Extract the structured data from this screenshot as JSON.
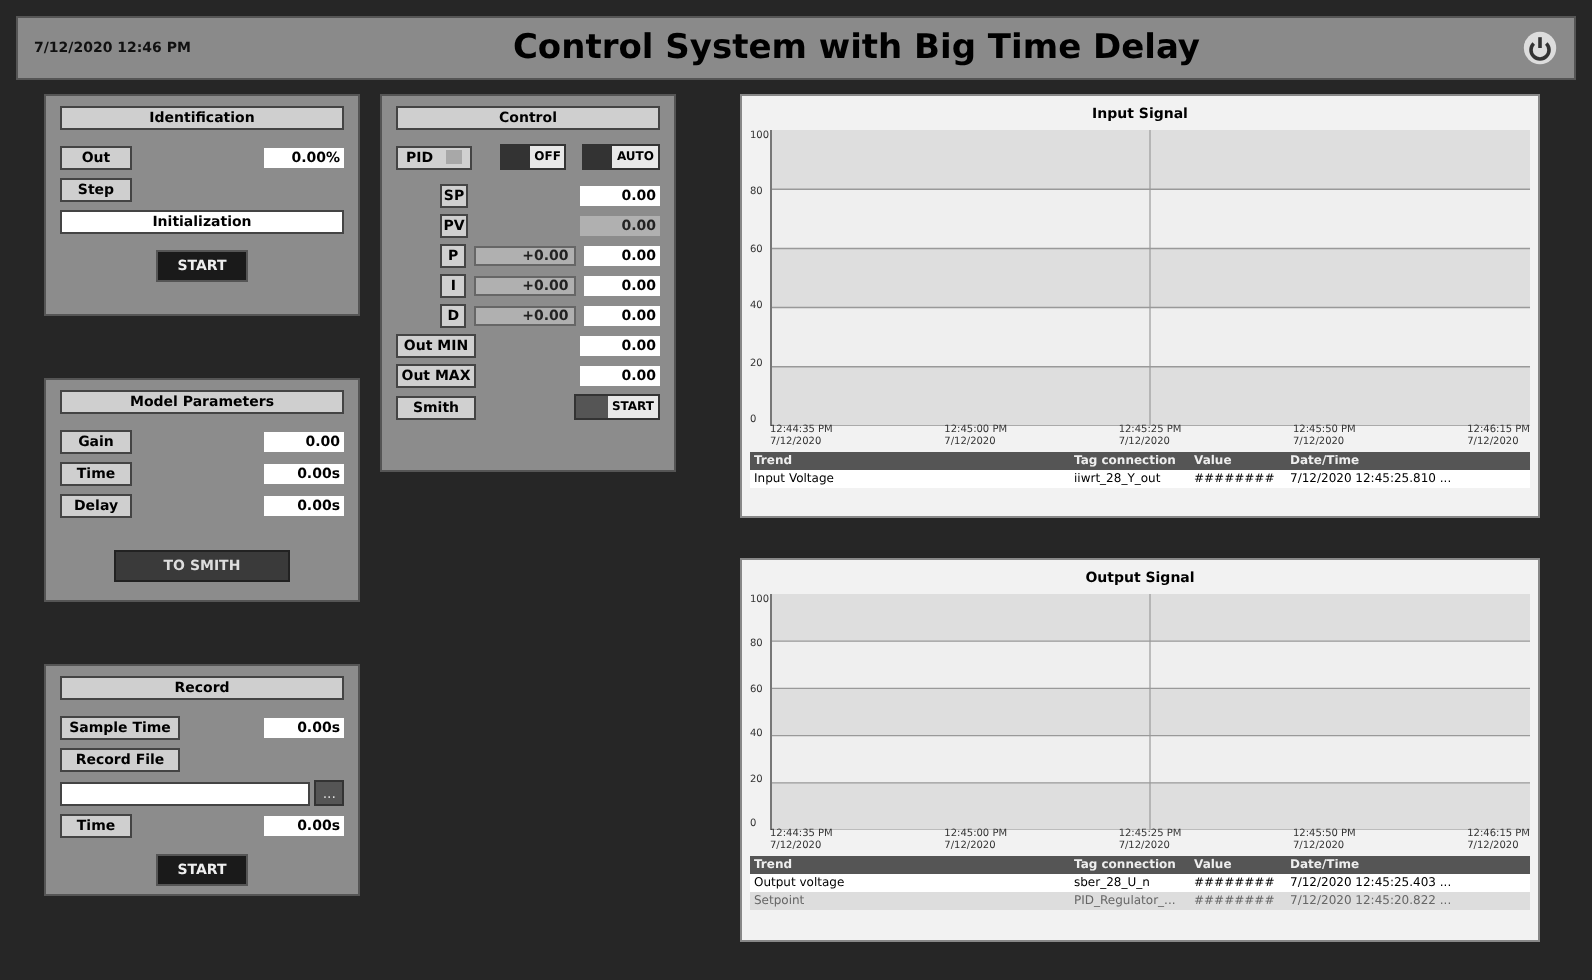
{
  "header": {
    "datetime": "7/12/2020 12:46 PM",
    "title": "Control System with Big Time Delay"
  },
  "left_panels": [
    {
      "title": "Identification",
      "items": [
        {
          "kind": "field",
          "label": "Out",
          "value": "0.00%"
        },
        {
          "kind": "label",
          "label": "Step"
        },
        {
          "kind": "display",
          "value": "Initialization"
        },
        {
          "kind": "button",
          "label": "START"
        }
      ]
    },
    {
      "title": "Model Parameters",
      "items": [
        {
          "kind": "field",
          "label": "Gain",
          "value": "0.00"
        },
        {
          "kind": "field",
          "label": "Time",
          "value": "0.00s"
        },
        {
          "kind": "field",
          "label": "Delay",
          "value": "0.00s"
        },
        {
          "kind": "wide-button",
          "label": "TO SMITH"
        }
      ]
    },
    {
      "title": "Record",
      "items": [
        {
          "kind": "field",
          "label": "Sample Time",
          "value": "0.00s"
        },
        {
          "kind": "label",
          "label": "Record File"
        },
        {
          "kind": "file",
          "button": "..."
        },
        {
          "kind": "field",
          "label": "Time",
          "value": "0.00s"
        },
        {
          "kind": "button",
          "label": "START"
        }
      ]
    }
  ],
  "control": {
    "title": "Control",
    "mode": {
      "label": "PID",
      "on": false
    },
    "switches": [
      {
        "label": "OFF",
        "on": false
      },
      {
        "label": "AUTO",
        "on": false
      }
    ],
    "rows": [
      {
        "label": "SP",
        "value": "0.00",
        "disabled": false
      },
      {
        "label": "PV",
        "value": "0.00",
        "disabled": true
      },
      {
        "label": "P",
        "reading": "+0.00",
        "value": "0.00",
        "disabled": false
      },
      {
        "label": "I",
        "reading": "+0.00",
        "value": "0.00",
        "disabled": false
      },
      {
        "label": "D",
        "reading": "+0.00",
        "value": "0.00",
        "disabled": false
      },
      {
        "label": "Out MIN",
        "value": "0.00",
        "disabled": false
      },
      {
        "label": "Out MAX",
        "value": "0.00",
        "disabled": false
      }
    ],
    "smith": {
      "label": "Smith",
      "switch": {
        "label": "START",
        "on": false
      }
    }
  },
  "charts": [
    {
      "title": "Input Signal",
      "yticks": [
        "100",
        "80",
        "60",
        "40",
        "20",
        "0"
      ],
      "xticks": [
        {
          "time": "12:44:35 PM",
          "date": "7/12/2020"
        },
        {
          "time": "12:45:00 PM",
          "date": "7/12/2020"
        },
        {
          "time": "12:45:25 PM",
          "date": "7/12/2020"
        },
        {
          "time": "12:45:50 PM",
          "date": "7/12/2020"
        },
        {
          "time": "12:46:15 PM",
          "date": "7/12/2020"
        }
      ],
      "legend_columns": [
        "Trend",
        "Tag connection",
        "Value",
        "Date/Time"
      ],
      "legend_rows": [
        {
          "selected": true,
          "cells": [
            "Input Voltage",
            "iiwrt_28_Y_out",
            "########",
            "7/12/2020 12:45:25.810 ..."
          ]
        }
      ]
    },
    {
      "title": "Output Signal",
      "yticks": [
        "100",
        "80",
        "60",
        "40",
        "20",
        "0"
      ],
      "xticks": [
        {
          "time": "12:44:35 PM",
          "date": "7/12/2020"
        },
        {
          "time": "12:45:00 PM",
          "date": "7/12/2020"
        },
        {
          "time": "12:45:25 PM",
          "date": "7/12/2020"
        },
        {
          "time": "12:45:50 PM",
          "date": "7/12/2020"
        },
        {
          "time": "12:46:15 PM",
          "date": "7/12/2020"
        }
      ],
      "legend_columns": [
        "Trend",
        "Tag connection",
        "Value",
        "Date/Time"
      ],
      "legend_rows": [
        {
          "selected": true,
          "cells": [
            "Output voltage",
            "sber_28_U_n",
            "########",
            "7/12/2020 12:45:25.403 ..."
          ]
        },
        {
          "selected": false,
          "cells": [
            "Setpoint",
            "PID_Regulator_...",
            "########",
            "7/12/2020 12:45:20.822 ..."
          ]
        }
      ]
    }
  ]
}
